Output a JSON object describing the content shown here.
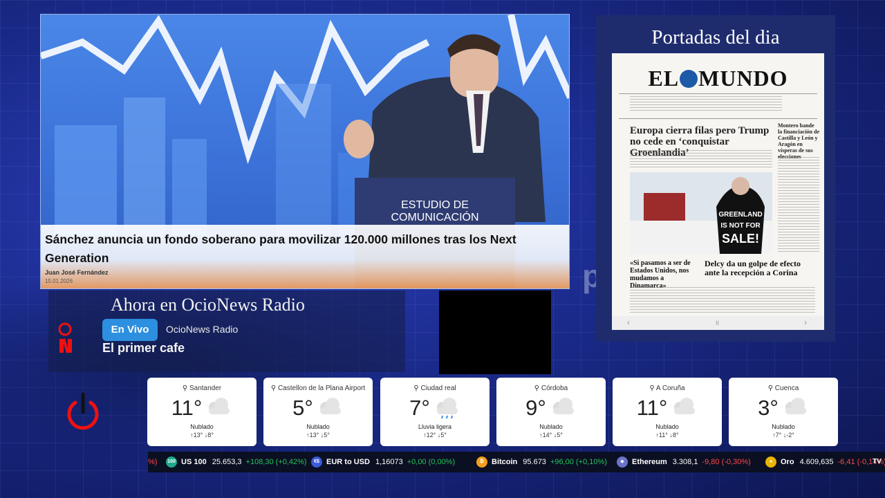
{
  "hero": {
    "title": "Sánchez anuncia un fondo soberano para movilizar 120.000 millones tras los Next Generation",
    "author": "Juan José Fernández",
    "date": "15.01.2026",
    "podium_line1": "ESTUDIO DE",
    "podium_line2": "COMUNICACIÓN"
  },
  "radio": {
    "title": "Ahora en OcioNews Radio",
    "live_label": "En Vivo",
    "station": "OcioNews Radio",
    "show": "El primer cafe"
  },
  "portadas": {
    "title": "Portadas del dia",
    "paper_name_left": "EL",
    "paper_name_right": "MUNDO",
    "headline": "Europa cierra filas pero Trump no cede en ‘conquistar Groenlandia’",
    "sub1": "«Si pasamos a ser de Estados Unidos, nos mudamos a Dinamarca»",
    "sub2": "Delcy da un golpe de efecto ante la recepción a Corina",
    "side": "Montero bande la financiación de Castilla y León y Aragón en vísperas de sus elecciones",
    "shirt_line1": "GREENLAND",
    "shirt_line2": "IS NOT FOR",
    "shirt_line3": "SALE!",
    "prev": "‹",
    "next": "›",
    "pause": "II"
  },
  "ghost_text": "pe",
  "weather": [
    {
      "city": "Santander",
      "temp": "11°",
      "desc": "Nublado",
      "range": "↑13°  ↓8°",
      "icon": "cloud"
    },
    {
      "city": "Castellon de la Plana Airport",
      "temp": "5°",
      "desc": "Nublado",
      "range": "↑13°  ↓5°",
      "icon": "cloud"
    },
    {
      "city": "Ciudad real",
      "temp": "7°",
      "desc": "Lluvia ligera",
      "range": "↑12°  ↓5°",
      "icon": "rain-cloud"
    },
    {
      "city": "Córdoba",
      "temp": "9°",
      "desc": "Nublado",
      "range": "↑14°  ↓5°",
      "icon": "cloud"
    },
    {
      "city": "A Coruña",
      "temp": "11°",
      "desc": "Nublado",
      "range": "↑11°  ↓8°",
      "icon": "cloud"
    },
    {
      "city": "Cuenca",
      "temp": "3°",
      "desc": "Nublado",
      "range": "↑7°  ↓-2°",
      "icon": "cloud"
    }
  ],
  "ticker": [
    {
      "prefix": "%)",
      "name": "",
      "price": "",
      "change": "",
      "dir": ""
    },
    {
      "icon_text": "100",
      "name": "US 100",
      "price": "25.653,3",
      "change": "+108,30 (+0,42%)",
      "dir": "up",
      "color": "#1fa98a"
    },
    {
      "icon_text": "€$",
      "name": "EUR to USD",
      "price": "1,16073",
      "change": "+0,00 (0,00%)",
      "dir": "up",
      "color": "#3a5bd9"
    },
    {
      "icon_text": "₿",
      "name": "Bitcoin",
      "price": "95.673",
      "change": "+96,00 (+0,10%)",
      "dir": "up",
      "color": "#f2a01c"
    },
    {
      "icon_text": "◆",
      "name": "Ethereum",
      "price": "3.308,1",
      "change": "-9,80 (-0,30%)",
      "dir": "down",
      "color": "#6a74c9"
    },
    {
      "icon_text": "●",
      "name": "Oro",
      "price": "4.609,635",
      "change": "-6,41 (-0,14%)",
      "dir": "down",
      "color": "#e8b600"
    }
  ],
  "ticker_end": "TV"
}
